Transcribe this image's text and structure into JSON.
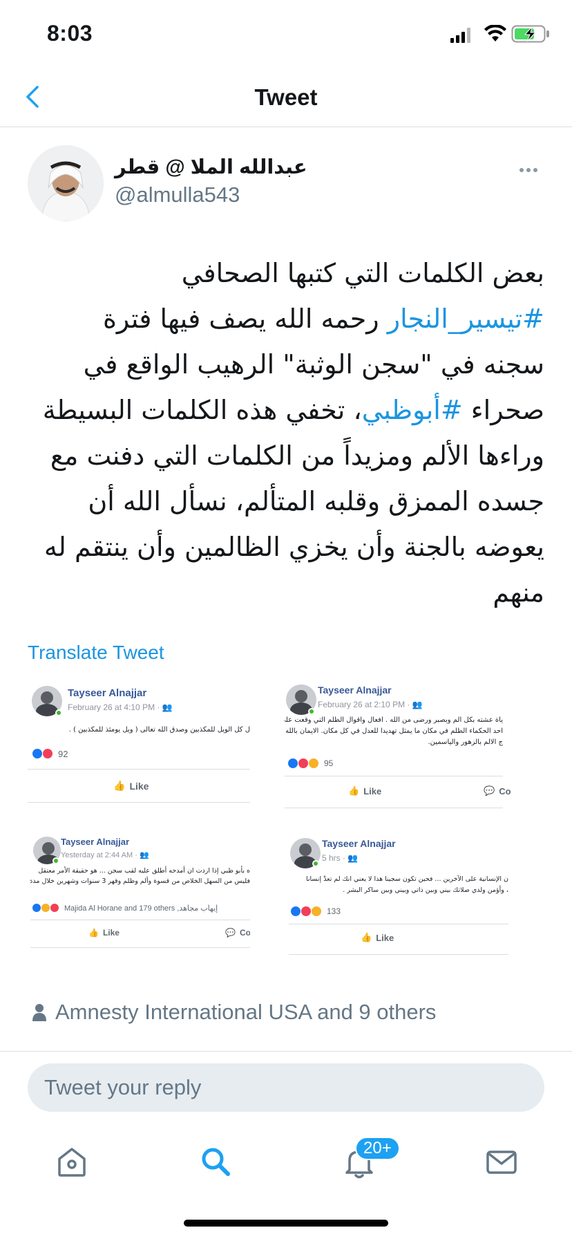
{
  "status_bar": {
    "time": "8:03"
  },
  "nav": {
    "title": "Tweet"
  },
  "author": {
    "name": "عبدالله الملا @ قطر",
    "handle": "@almulla543"
  },
  "tweet": {
    "text_before_tag1": "بعض الكلمات التي كتبها الصحافي ",
    "hashtag1": "#تيسير_النجار",
    "text_between": " رحمه الله يصف فيها فترة سجنه في \"سجن الوثبة\" الرهيب الواقع في صحراء ",
    "hashtag2": "#أبوظبي",
    "text_after": "، تخفي هذه الكلمات البسيطة وراءها الألم ومزيداً من الكلمات التي دفنت مع جسده الممزق وقلبه المتألم، نسأل الله أن يعوضه بالجنة وأن يخزي الظالمين وأن ينتقم له منهم"
  },
  "translate_label": "Translate Tweet",
  "media_posts": [
    {
      "name": "Tayseer Alnajjar",
      "date": "February 26 at 4:10 PM · ",
      "body": [
        "ل كل الويل للمكذبين وصدق الله تعالى ( ويل يومئذ للمكذبين ) ."
      ],
      "reactions": "92",
      "like_label": "Like"
    },
    {
      "name": "Tayseer Alnajjar",
      "date": "February 26 at 2:10 PM · ",
      "body": [
        "ياة عشته بكل الم وبصبر ورضى من الله . افعال واقوال الظلم التي وقعت علي",
        "احد الحكماء الظلم في مكان ما يمثل تهديدا للعدل في كل مكان. الايمان بالله انه",
        "ج الالم بالزهور والياسمين."
      ],
      "reactions": "95",
      "like_label": "Like",
      "comment_label": "Co"
    },
    {
      "name": "Tayseer Alnajjar",
      "date": "Yesterday at 2:44 AM · ",
      "body": [
        "ه بأبو ظبي إذا اردت ان أمدحه أطلق عليه لقب سجن ... هو حقيقة الأمر معتقل",
        "فليس من السهل الخلاص من قسوة وألم وظلم وقهر 3 سنوات وشهرين خلال مدة"
      ],
      "reactions": "Majida Al Horane and 179 others ,إيهاب مجاهد",
      "like_label": "Like",
      "comment_label": "Co"
    },
    {
      "name": "Tayseer Alnajjar",
      "date": "5 hrs · ",
      "body": [
        "ن الإنسانية على الآخرين ... فحين تكون سجينا هذا لا يعني انك لم تعدْ إنسانا",
        "، وأؤمن ولدي صلاتك بيني وبين ذاتي وبيني وبين ساكر البشر ."
      ],
      "reactions": "133",
      "like_label": "Like"
    }
  ],
  "likes_line": "Amnesty International USA and 9 others",
  "reply": {
    "placeholder": "Tweet your reply"
  },
  "tabs": {
    "notifications_badge": "20+"
  },
  "colors": {
    "accent": "#1da1f2",
    "link": "#1b95e0",
    "secondary_text": "#657786",
    "reply_bg": "#e6ecf0"
  }
}
